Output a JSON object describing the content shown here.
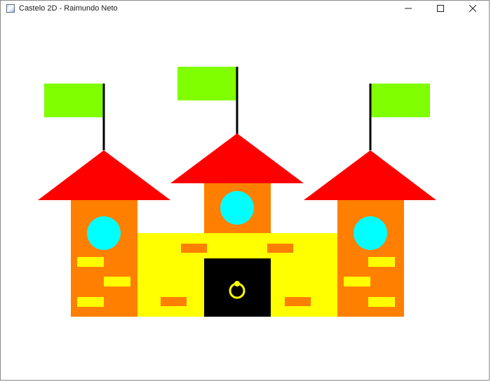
{
  "window": {
    "title": "Castelo 2D - Raimundo Neto",
    "controls": {
      "minimize_icon": "minimize-icon",
      "maximize_icon": "maximize-icon",
      "close_icon": "close-icon"
    }
  },
  "colors": {
    "flag": "#7fff00",
    "pole": "#000000",
    "roof": "#ff0000",
    "tower": "#ff7f00",
    "window": "#00ffff",
    "wall": "#ffff00",
    "brick_on_tower": "#ffff00",
    "brick_on_wall": "#ff7f00",
    "door": "#000000",
    "door_knocker": "#ffff00"
  }
}
